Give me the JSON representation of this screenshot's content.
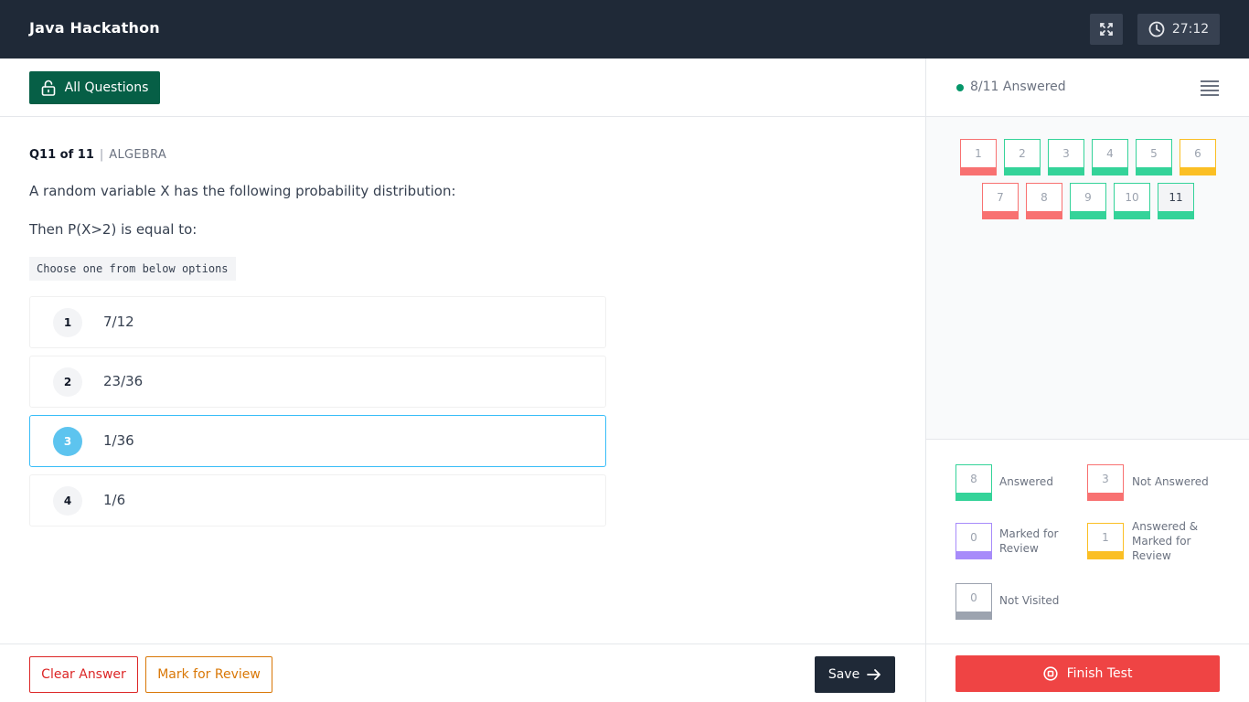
{
  "header": {
    "title": "Java Hackathon",
    "fullscreen_icon": "fullscreen-icon",
    "timer_icon": "clock-icon",
    "timer": "27:12"
  },
  "toolbar": {
    "all_questions_label": "All Questions",
    "all_questions_icon": "unlock-icon"
  },
  "question": {
    "number": "Q11 of 11",
    "separator": "|",
    "topic": "ALGEBRA",
    "text1": "A random variable X has the following probability distribution:",
    "text2": "Then P(X>2) is equal to:",
    "instruction": "Choose one from below options",
    "selected_option": 3,
    "options": [
      {
        "num": "1",
        "text": "7/12"
      },
      {
        "num": "2",
        "text": "23/36"
      },
      {
        "num": "3",
        "text": "1/36"
      },
      {
        "num": "4",
        "text": "1/6"
      }
    ]
  },
  "footer": {
    "clear_label": "Clear Answer",
    "mark_label": "Mark for Review",
    "save_label": "Save",
    "save_icon": "arrow-right-icon",
    "finish_label": "Finish Test",
    "finish_icon": "stop-circle-icon"
  },
  "sidebar": {
    "answered_summary": "8/11 Answered",
    "menu_icon": "menu-icon",
    "questions": [
      {
        "num": "1",
        "status": "not-answered"
      },
      {
        "num": "2",
        "status": "answered"
      },
      {
        "num": "3",
        "status": "answered"
      },
      {
        "num": "4",
        "status": "answered"
      },
      {
        "num": "5",
        "status": "answered"
      },
      {
        "num": "6",
        "status": "answered-marked"
      },
      {
        "num": "7",
        "status": "not-answered"
      },
      {
        "num": "8",
        "status": "not-answered"
      },
      {
        "num": "9",
        "status": "answered"
      },
      {
        "num": "10",
        "status": "answered"
      },
      {
        "num": "11",
        "status": "answered",
        "current": true
      }
    ],
    "legend": {
      "answered": {
        "count": "8",
        "label": "Answered"
      },
      "not_answered": {
        "count": "3",
        "label": "Not Answered"
      },
      "marked": {
        "count": "0",
        "label_1": "Marked for",
        "label_2": "Review"
      },
      "answered_marked": {
        "count": "1",
        "label_1": "Answered &",
        "label_2": "Marked for",
        "label_3": "Review"
      },
      "not_visited": {
        "count": "0",
        "label": "Not Visited"
      }
    }
  },
  "colors": {
    "header_bg": "#1f2937",
    "primary_green": "#065f46",
    "answered": "#34d399",
    "not_answered": "#f87171",
    "marked": "#a78bfa",
    "answered_marked": "#fbbf24",
    "not_visited": "#9ca3af",
    "finish": "#ef4444",
    "selected": "#38bdf8"
  }
}
